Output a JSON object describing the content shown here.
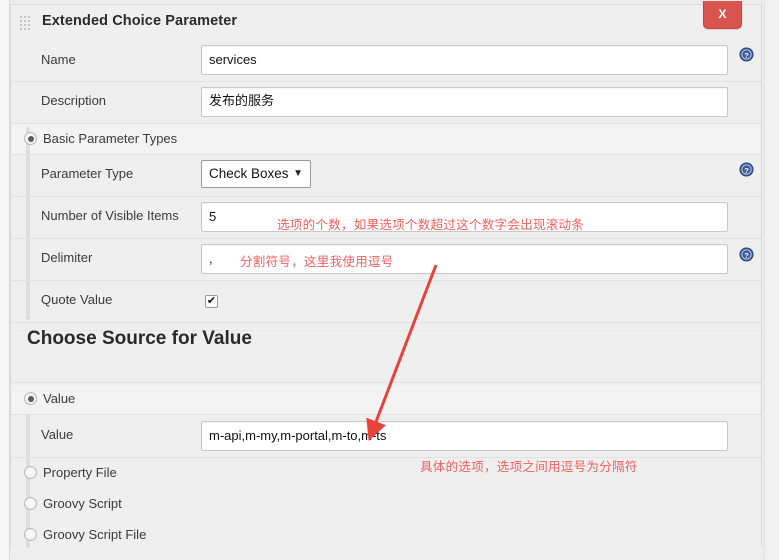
{
  "header": {
    "title": "Extended Choice Parameter",
    "close_label": "X",
    "grip_icon": "drag-grip-icon"
  },
  "fields": {
    "name": {
      "label": "Name",
      "value": "services",
      "help_icon": "help-icon"
    },
    "description": {
      "label": "Description",
      "value": "发布的服务"
    },
    "basic_parameter_types": {
      "label": "Basic Parameter Types",
      "selected": true
    },
    "parameter_type": {
      "label": "Parameter Type",
      "value": "Check Boxes",
      "caret_icon": "chevron-down-icon",
      "help_icon": "help-icon",
      "options": [
        "Check Boxes"
      ]
    },
    "number_of_visible_items": {
      "label": "Number of Visible Items",
      "value": "5"
    },
    "delimiter": {
      "label": "Delimiter",
      "value": ",",
      "help_icon": "help-icon"
    },
    "quote_value": {
      "label": "Quote Value",
      "checked": true,
      "check_glyph": "✔"
    }
  },
  "source_section": {
    "title": "Choose Source for Value",
    "options": [
      {
        "label": "Value",
        "selected": true
      },
      {
        "label": "Property File",
        "selected": false
      },
      {
        "label": "Groovy Script",
        "selected": false
      },
      {
        "label": "Groovy Script File",
        "selected": false
      }
    ],
    "value_field": {
      "label": "Value",
      "value": "m-api,m-my,m-portal,m-to,m-ts"
    }
  },
  "annotations": [
    {
      "text": "选项的个数，如果选项个数超过这个数字会出现滚动条"
    },
    {
      "text": "分割符号，这里我使用逗号"
    },
    {
      "text": "具体的选项，选项之间用逗号为分隔符"
    }
  ],
  "colors": {
    "annotation_red": "#f0625f",
    "close_button_red": "#d9534f",
    "help_blue": "#3b5a9a",
    "panel_bg": "#efefef"
  }
}
